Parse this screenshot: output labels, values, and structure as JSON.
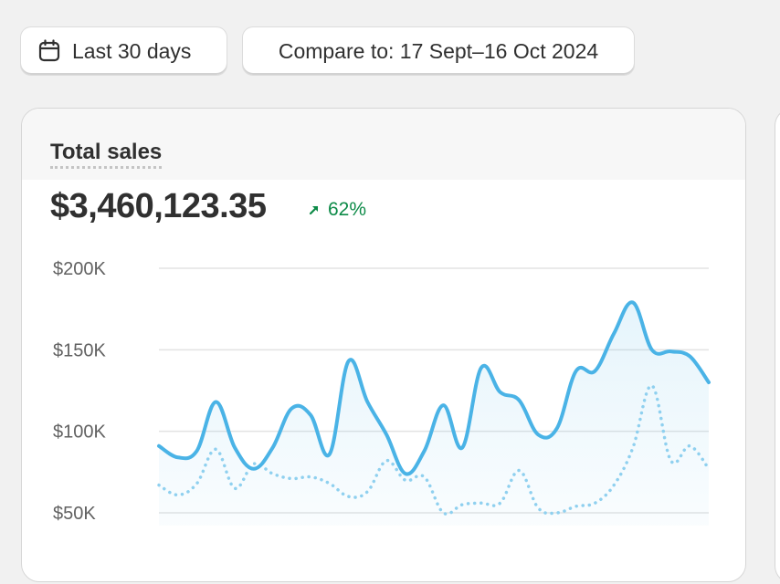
{
  "toolbar": {
    "date_range_label": "Last 30 days",
    "compare_label": "Compare to: 17 Sept–16 Oct 2024",
    "date_icon": "calendar-icon"
  },
  "card": {
    "title": "Total sales",
    "value": "$3,460,123.35",
    "change": "62%",
    "change_icon": "arrow-up-right-icon",
    "change_color": "#0c8a47"
  },
  "colors": {
    "current_series": "#4ab3e6",
    "previous_series": "#8fd0ef"
  },
  "chart_data": {
    "type": "line",
    "y_ticks": [
      "$200K",
      "$150K",
      "$100K",
      "$50K"
    ],
    "y_tick_values": [
      200000,
      150000,
      100000,
      50000
    ],
    "ylim": [
      50000,
      200000
    ],
    "grid": true,
    "x_count": 30,
    "series": [
      {
        "style": "solid",
        "values": [
          91000,
          84000,
          88000,
          118000,
          90000,
          77000,
          90000,
          114000,
          110000,
          86000,
          143000,
          118000,
          98000,
          74000,
          88000,
          116000,
          90000,
          139000,
          124000,
          119000,
          98000,
          102000,
          137000,
          137000,
          160000,
          179000,
          150000,
          149000,
          146000,
          130000
        ]
      },
      {
        "style": "dotted",
        "values": [
          67000,
          61000,
          68000,
          89000,
          65000,
          80000,
          74000,
          71000,
          72000,
          68000,
          60000,
          63000,
          82000,
          70000,
          72000,
          50000,
          55000,
          56000,
          56000,
          76000,
          53000,
          50000,
          54000,
          56000,
          67000,
          90000,
          128000,
          82000,
          91000,
          77000
        ]
      }
    ]
  }
}
